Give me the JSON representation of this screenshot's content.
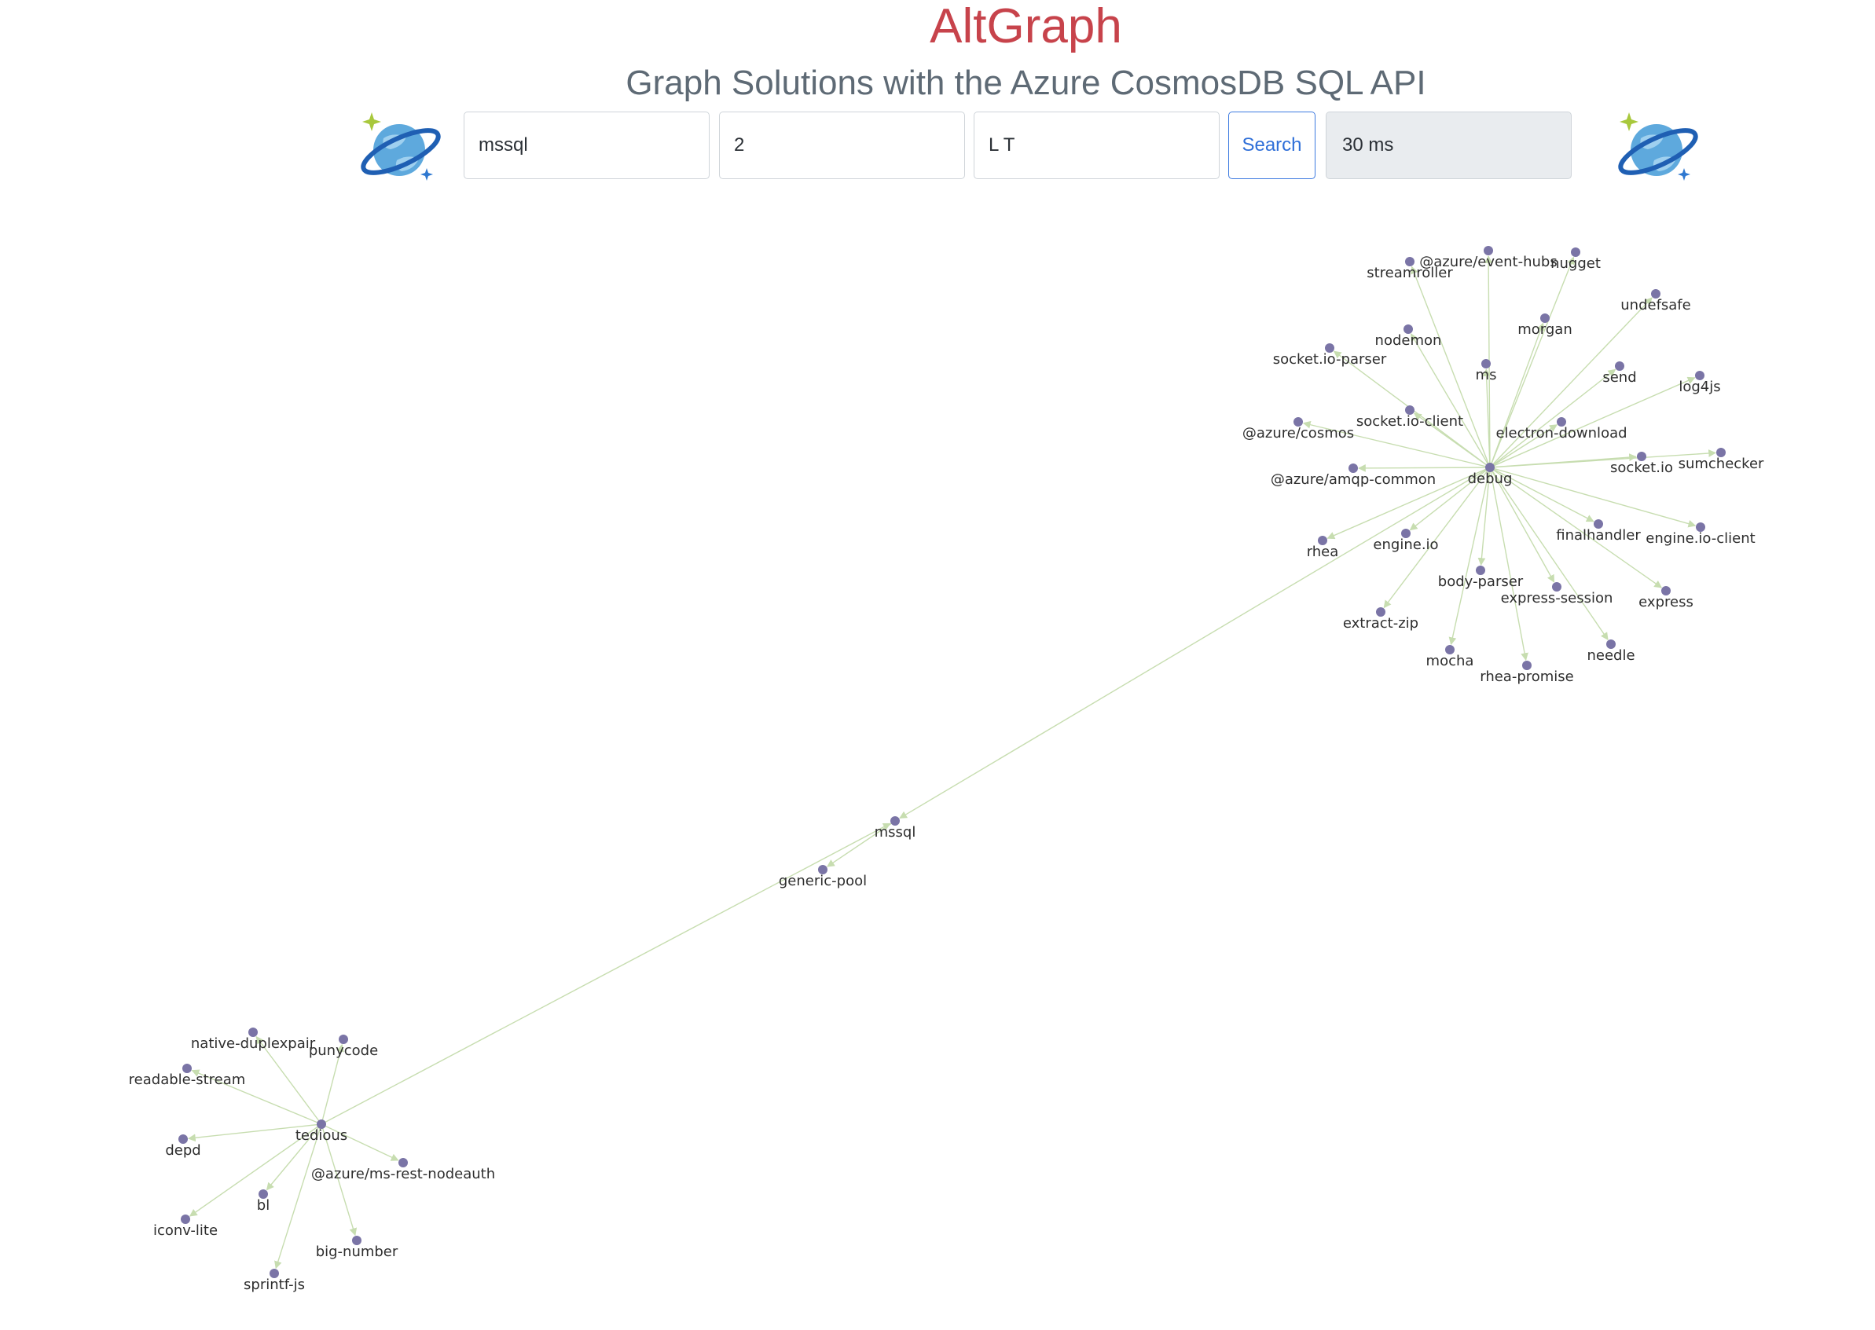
{
  "header": {
    "title": "AltGraph",
    "subtitle": "Graph Solutions with the Azure CosmosDB SQL API"
  },
  "logo": {
    "icon": "cosmos-db-planet-icon"
  },
  "search": {
    "library": "mssql",
    "depth": "2",
    "direction": "L T",
    "button_label": "Search",
    "elapsed": "30 ms"
  },
  "colors": {
    "title": "#c7434b",
    "subtitle": "#5e6a75",
    "node": "#7a74a6",
    "edge": "#c7ddb0",
    "button": "#2f6fd8"
  },
  "graph": {
    "nodes": [
      {
        "id": "debug"
      },
      {
        "id": "streamroller"
      },
      {
        "id": "@azure/event-hubs"
      },
      {
        "id": "nugget"
      },
      {
        "id": "undefsafe"
      },
      {
        "id": "morgan"
      },
      {
        "id": "nodemon"
      },
      {
        "id": "socket.io-parser"
      },
      {
        "id": "ms"
      },
      {
        "id": "send"
      },
      {
        "id": "log4js"
      },
      {
        "id": "socket.io-client"
      },
      {
        "id": "@azure/cosmos"
      },
      {
        "id": "electron-download"
      },
      {
        "id": "socket.io"
      },
      {
        "id": "sumchecker"
      },
      {
        "id": "@azure/amqp-common"
      },
      {
        "id": "rhea"
      },
      {
        "id": "engine.io"
      },
      {
        "id": "finalhandler"
      },
      {
        "id": "engine.io-client"
      },
      {
        "id": "body-parser"
      },
      {
        "id": "express-session"
      },
      {
        "id": "express"
      },
      {
        "id": "extract-zip"
      },
      {
        "id": "mocha"
      },
      {
        "id": "needle"
      },
      {
        "id": "rhea-promise"
      },
      {
        "id": "mssql"
      },
      {
        "id": "generic-pool"
      },
      {
        "id": "tedious"
      },
      {
        "id": "native-duplexpair"
      },
      {
        "id": "punycode"
      },
      {
        "id": "readable-stream"
      },
      {
        "id": "depd"
      },
      {
        "id": "@azure/ms-rest-nodeauth"
      },
      {
        "id": "bl"
      },
      {
        "id": "iconv-lite"
      },
      {
        "id": "big-number"
      },
      {
        "id": "sprintf-js"
      }
    ],
    "edges": [
      {
        "from": "debug",
        "to": "streamroller"
      },
      {
        "from": "debug",
        "to": "@azure/event-hubs"
      },
      {
        "from": "debug",
        "to": "nugget"
      },
      {
        "from": "debug",
        "to": "undefsafe"
      },
      {
        "from": "debug",
        "to": "morgan"
      },
      {
        "from": "debug",
        "to": "nodemon"
      },
      {
        "from": "debug",
        "to": "socket.io-parser"
      },
      {
        "from": "debug",
        "to": "ms"
      },
      {
        "from": "debug",
        "to": "send"
      },
      {
        "from": "debug",
        "to": "log4js"
      },
      {
        "from": "debug",
        "to": "socket.io-client"
      },
      {
        "from": "debug",
        "to": "@azure/cosmos"
      },
      {
        "from": "debug",
        "to": "electron-download"
      },
      {
        "from": "debug",
        "to": "socket.io"
      },
      {
        "from": "debug",
        "to": "sumchecker"
      },
      {
        "from": "debug",
        "to": "@azure/amqp-common"
      },
      {
        "from": "debug",
        "to": "rhea"
      },
      {
        "from": "debug",
        "to": "engine.io"
      },
      {
        "from": "debug",
        "to": "finalhandler"
      },
      {
        "from": "debug",
        "to": "engine.io-client"
      },
      {
        "from": "debug",
        "to": "body-parser"
      },
      {
        "from": "debug",
        "to": "express-session"
      },
      {
        "from": "debug",
        "to": "express"
      },
      {
        "from": "debug",
        "to": "extract-zip"
      },
      {
        "from": "debug",
        "to": "mocha"
      },
      {
        "from": "debug",
        "to": "needle"
      },
      {
        "from": "debug",
        "to": "rhea-promise"
      },
      {
        "from": "debug",
        "to": "mssql"
      },
      {
        "from": "mssql",
        "to": "generic-pool"
      },
      {
        "from": "tedious",
        "to": "mssql"
      },
      {
        "from": "tedious",
        "to": "native-duplexpair"
      },
      {
        "from": "tedious",
        "to": "punycode"
      },
      {
        "from": "tedious",
        "to": "readable-stream"
      },
      {
        "from": "tedious",
        "to": "depd"
      },
      {
        "from": "tedious",
        "to": "@azure/ms-rest-nodeauth"
      },
      {
        "from": "tedious",
        "to": "bl"
      },
      {
        "from": "tedious",
        "to": "iconv-lite"
      },
      {
        "from": "tedious",
        "to": "big-number"
      },
      {
        "from": "tedious",
        "to": "sprintf-js"
      }
    ]
  }
}
